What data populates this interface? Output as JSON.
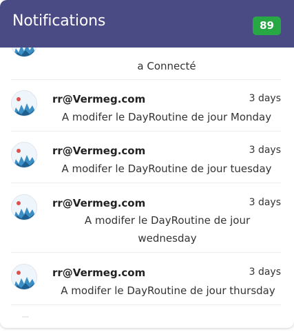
{
  "header": {
    "title": "Notifications",
    "badge_count": "89"
  },
  "colors": {
    "header_bg": "#4a4a84",
    "badge_bg": "#28a745"
  },
  "notifications": [
    {
      "sender": "",
      "time": "",
      "message": "a Connecté",
      "avatar_icon": "crowd-avatar-icon"
    },
    {
      "sender": "rr@Vermeg.com",
      "time": "3 days",
      "message": "A modifer le DayRoutine de jour Monday",
      "avatar_icon": "crowd-avatar-icon"
    },
    {
      "sender": "rr@Vermeg.com",
      "time": "3 days",
      "message": "A modifer le DayRoutine de jour tuesday",
      "avatar_icon": "crowd-avatar-icon"
    },
    {
      "sender": "rr@Vermeg.com",
      "time": "3 days",
      "message": "A modifer le DayRoutine de jour wednesday",
      "avatar_icon": "crowd-avatar-icon"
    },
    {
      "sender": "rr@Vermeg.com",
      "time": "3 days",
      "message": "A modifer le DayRoutine de jour thursday",
      "avatar_icon": "crowd-avatar-icon"
    }
  ]
}
